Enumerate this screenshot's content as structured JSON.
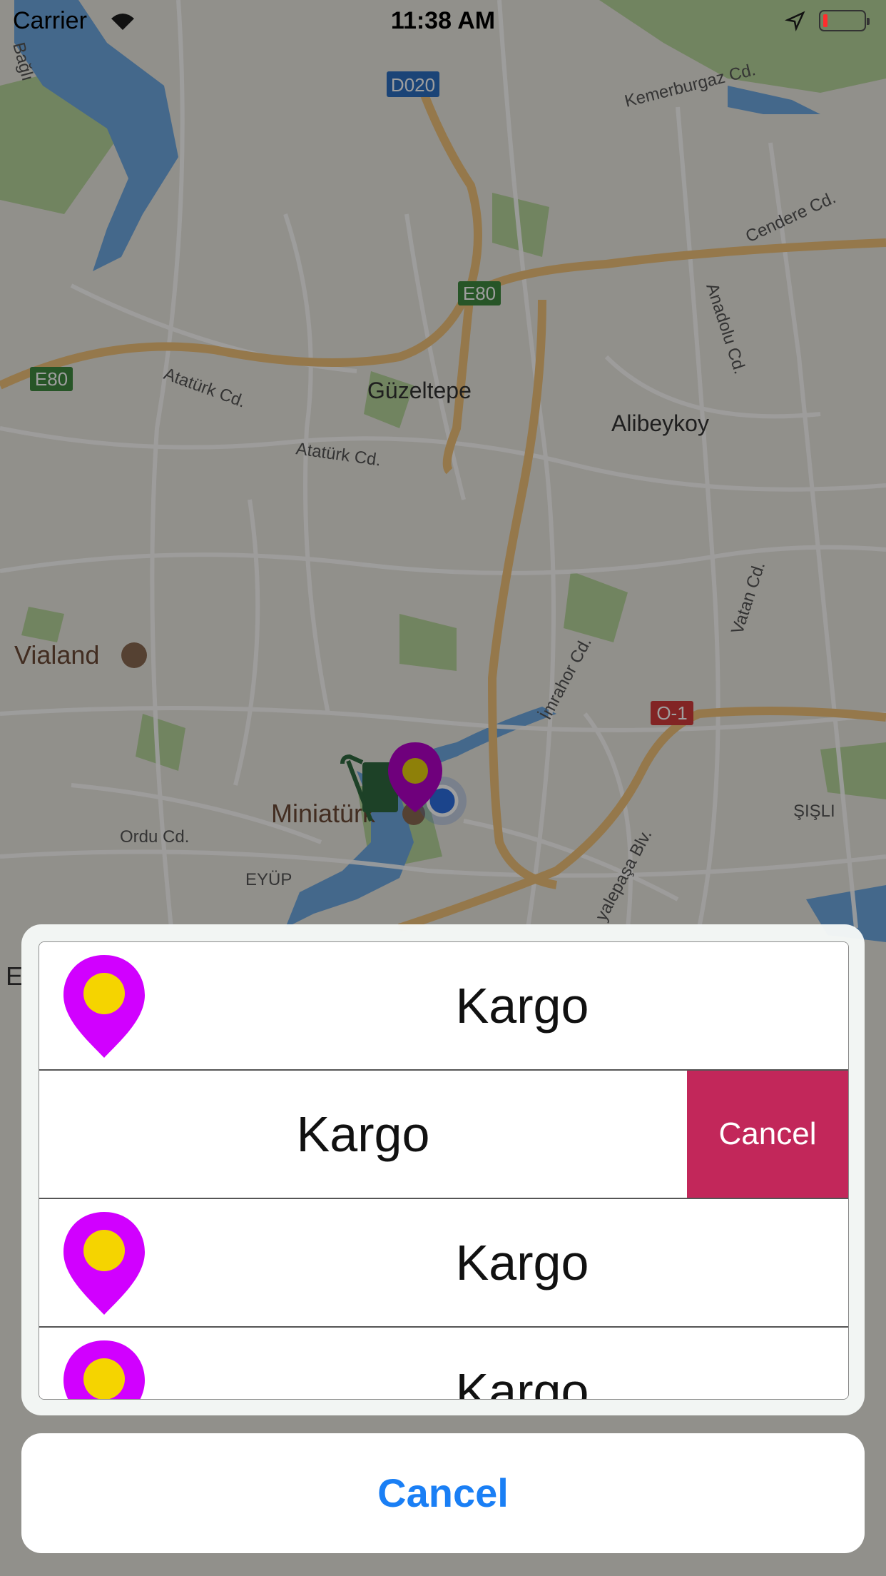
{
  "status_bar": {
    "carrier": "Carrier",
    "time": "11:38 AM"
  },
  "map": {
    "labels": {
      "d020": "D020",
      "e80_a": "E80",
      "e80_b": "E80",
      "o1": "O-1",
      "guzeltepe": "Güzeltepe",
      "alibeykoy": "Alibeykoy",
      "vialand": "Vialand",
      "miniaturk": "Miniatürk",
      "eyup": "EYÜP",
      "sisli": "ŞIŞLI",
      "kemerburgaz": "Kemerburgaz Cd.",
      "cendere": "Cendere Cd.",
      "anadolu": "Anadolu Cd.",
      "ataturk1": "Atatürk Cd.",
      "ataturk2": "Atatürk Cd.",
      "imrahor": "İmrahor Cd.",
      "vatan": "Vatan Cd.",
      "ordu": "Ordu Cd.",
      "yalepasa": "yalepaşa Blv.",
      "edge_b": "Bağlı",
      "edge_e": "E"
    }
  },
  "sheet": {
    "rows": [
      {
        "label": "Kargo",
        "icon": "map-pin-icon"
      },
      {
        "label": "Kargo",
        "action": "Cancel"
      },
      {
        "label": "Kargo",
        "icon": "map-pin-icon"
      },
      {
        "label": "Kargo",
        "icon": "map-pin-icon"
      }
    ],
    "cancel_label": "Cancel"
  },
  "colors": {
    "pin": "#d100ff",
    "pin_dot": "#f5d400",
    "delete_action": "#c2275a",
    "cancel_text": "#1a7ff5"
  }
}
